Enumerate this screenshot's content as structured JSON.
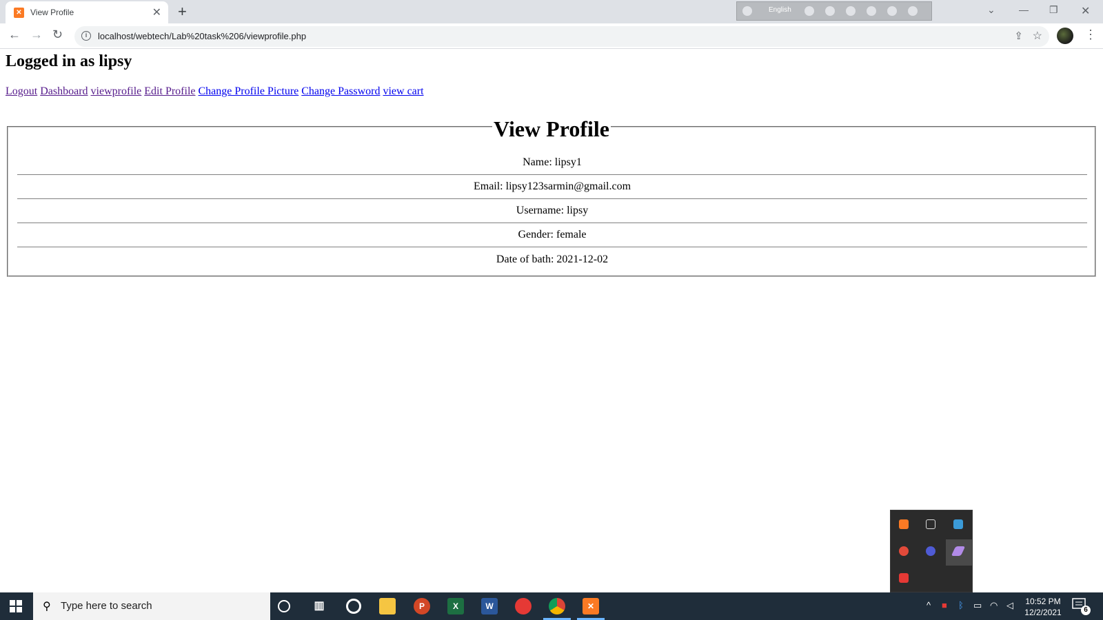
{
  "browser": {
    "tab_title": "View Profile",
    "url": "localhost/webtech/Lab%20task%206/viewprofile.php",
    "ime_language": "English"
  },
  "page": {
    "greeting": "Logged in as lipsy",
    "links": [
      {
        "label": "Logout",
        "visited": true
      },
      {
        "label": "Dashboard",
        "visited": true
      },
      {
        "label": "viewprofile",
        "visited": true
      },
      {
        "label": "Edit Profile",
        "visited": true
      },
      {
        "label": "Change Profile Picture",
        "visited": false
      },
      {
        "label": "Change Password",
        "visited": false
      },
      {
        "label": "view cart",
        "visited": false
      }
    ],
    "legend": "View Profile",
    "rows": [
      "Name: lipsy1",
      "Email: lipsy123sarmin@gmail.com",
      "Username: lipsy",
      "Gender: female",
      "Date of bath: 2021-12-02"
    ]
  },
  "taskbar": {
    "search_placeholder": "Type here to search",
    "time": "10:52 PM",
    "date": "12/2/2021",
    "notification_count": "6",
    "apps": [
      {
        "name": "cortana-icon"
      },
      {
        "name": "task-view-icon"
      },
      {
        "name": "app-circle-icon"
      },
      {
        "name": "file-explorer-icon"
      },
      {
        "name": "powerpoint-icon"
      },
      {
        "name": "excel-icon"
      },
      {
        "name": "word-icon"
      },
      {
        "name": "app-red-icon"
      },
      {
        "name": "chrome-icon"
      },
      {
        "name": "xampp-icon"
      }
    ]
  },
  "colors": {
    "link": "#0000ee",
    "link_visited": "#551a8b",
    "taskbar": "#1f2d3a",
    "xampp": "#fb7a24"
  }
}
